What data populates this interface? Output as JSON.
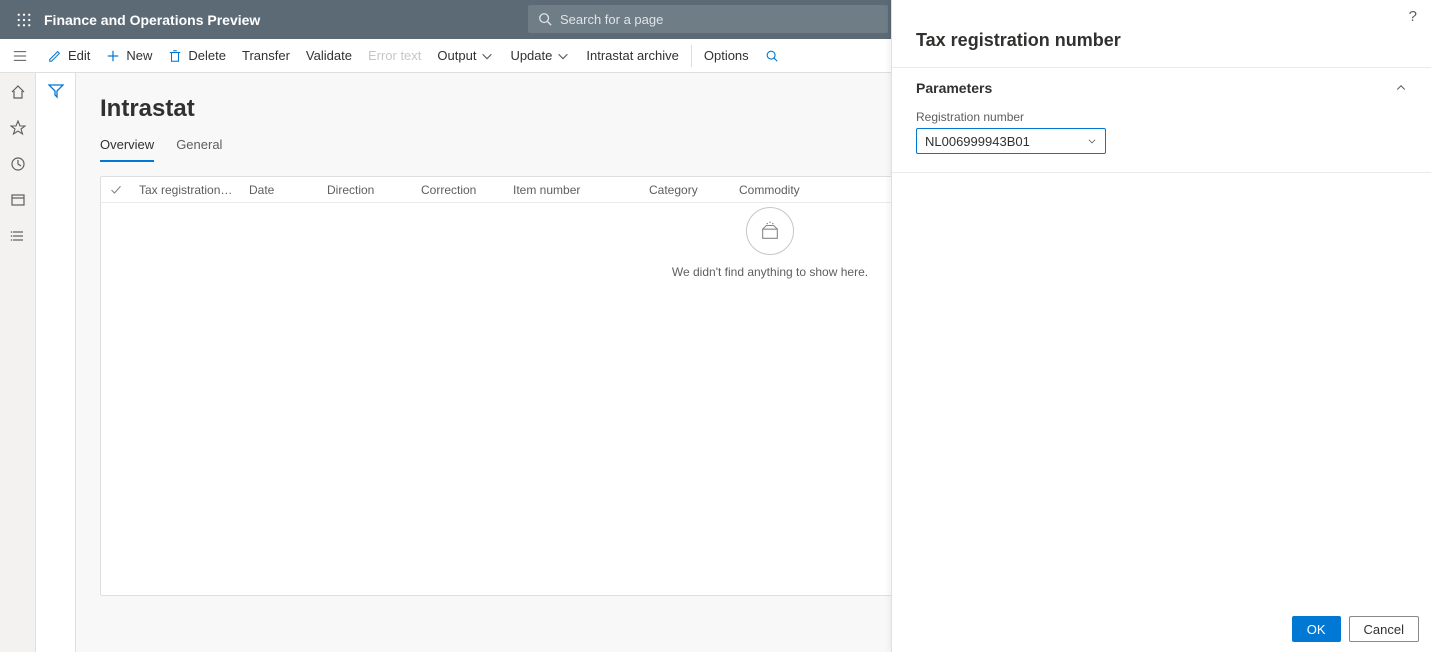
{
  "topbar": {
    "app_title": "Finance and Operations Preview",
    "search_placeholder": "Search for a page"
  },
  "commandbar": {
    "edit": "Edit",
    "new": "New",
    "delete": "Delete",
    "transfer": "Transfer",
    "validate": "Validate",
    "error_text": "Error text",
    "output": "Output",
    "update": "Update",
    "intrastat_archive": "Intrastat archive",
    "options": "Options"
  },
  "page": {
    "title": "Intrastat",
    "tabs": {
      "overview": "Overview",
      "general": "General"
    }
  },
  "grid": {
    "columns": {
      "tax_registration": "Tax registration num...",
      "date": "Date",
      "direction": "Direction",
      "correction": "Correction",
      "item_number": "Item number",
      "category": "Category",
      "commodity": "Commodity"
    },
    "empty_message": "We didn't find anything to show here."
  },
  "panel": {
    "title": "Tax registration number",
    "section_title": "Parameters",
    "field_label": "Registration number",
    "field_value": "NL006999943B01",
    "ok": "OK",
    "cancel": "Cancel"
  }
}
